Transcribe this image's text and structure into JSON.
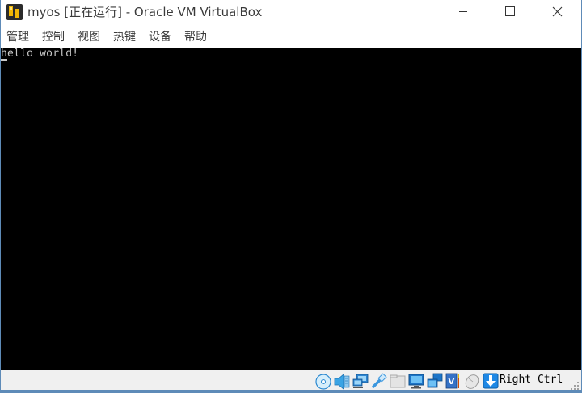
{
  "window": {
    "title": "myos [正在运行] - Oracle VM VirtualBox",
    "app_icon": "virtualbox-vm-icon",
    "controls": {
      "minimize_icon": "minimize-icon",
      "maximize_icon": "maximize-icon",
      "close_icon": "close-icon"
    }
  },
  "menubar": {
    "items": [
      {
        "label": "管理"
      },
      {
        "label": "控制"
      },
      {
        "label": "视图"
      },
      {
        "label": "热键"
      },
      {
        "label": "设备"
      },
      {
        "label": "帮助"
      }
    ]
  },
  "guest_screen": {
    "console_text": "hello world!",
    "background": "#000000",
    "text_color": "#c8c8c8"
  },
  "statusbar": {
    "icons": [
      "optical-drive-icon",
      "audio-icon",
      "network-icon",
      "usb-icon",
      "shared-folders-icon",
      "display-icon",
      "video-capture-icon",
      "virtualization-icon",
      "mouse-integration-icon",
      "keyboard-capture-icon"
    ],
    "host_key": "Right Ctrl"
  },
  "colors": {
    "accent": "#1e88e5",
    "border": "#5e8bb8"
  }
}
